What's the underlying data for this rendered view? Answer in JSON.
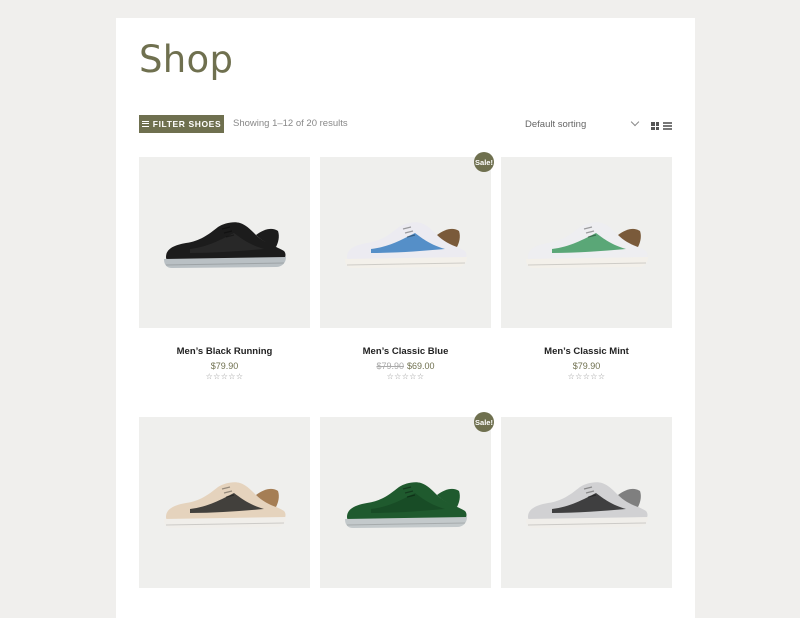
{
  "page": {
    "title": "Shop"
  },
  "toolbar": {
    "filter_label": "FILTER SHOES",
    "result_count": "Showing 1–12 of 20 results",
    "sort_selected": "Default sorting",
    "view_modes": [
      "grid-view-icon",
      "list-view-icon"
    ]
  },
  "products": [
    {
      "name": "Men’s Black Running",
      "price": "$79.90",
      "old_price": "",
      "sale": "",
      "rating": "☆☆☆☆☆",
      "shoe_colors": {
        "upper": "#1c1c1c",
        "accent": "#2a2a2a",
        "sole": "#b9c0c4",
        "heel": "#1c1c1c"
      }
    },
    {
      "name": "Men’s Classic Blue",
      "price": "$69.00",
      "old_price": "$79.90",
      "sale": "Sale!",
      "rating": "☆☆☆☆☆",
      "shoe_colors": {
        "upper": "#ecebf1",
        "accent": "#3b7fc1",
        "sole": "#f3f0ea",
        "heel": "#7a5a3a"
      }
    },
    {
      "name": "Men’s Classic Mint",
      "price": "$79.90",
      "old_price": "",
      "sale": "",
      "rating": "☆☆☆☆☆",
      "shoe_colors": {
        "upper": "#eeeef1",
        "accent": "#3f9a62",
        "sole": "#f3f0ea",
        "heel": "#7a5a3a"
      }
    },
    {
      "name": "",
      "price": "",
      "old_price": "",
      "sale": "",
      "rating": "",
      "shoe_colors": {
        "upper": "#e5d3bd",
        "accent": "#262626",
        "sole": "#f0eeea",
        "heel": "#a57e55"
      }
    },
    {
      "name": "",
      "price": "",
      "old_price": "",
      "sale": "Sale!",
      "rating": "",
      "shoe_colors": {
        "upper": "#1f5a2e",
        "accent": "#174a25",
        "sole": "#c3c9cb",
        "heel": "#1f5a2e"
      }
    },
    {
      "name": "",
      "price": "",
      "old_price": "",
      "sale": "",
      "rating": "",
      "shoe_colors": {
        "upper": "#d1d1d3",
        "accent": "#262626",
        "sole": "#f0eeea",
        "heel": "#7f7f7f"
      }
    }
  ],
  "colors": {
    "accent": "#6f704f",
    "background": "#f0efed",
    "card_bg": "#efefed"
  }
}
